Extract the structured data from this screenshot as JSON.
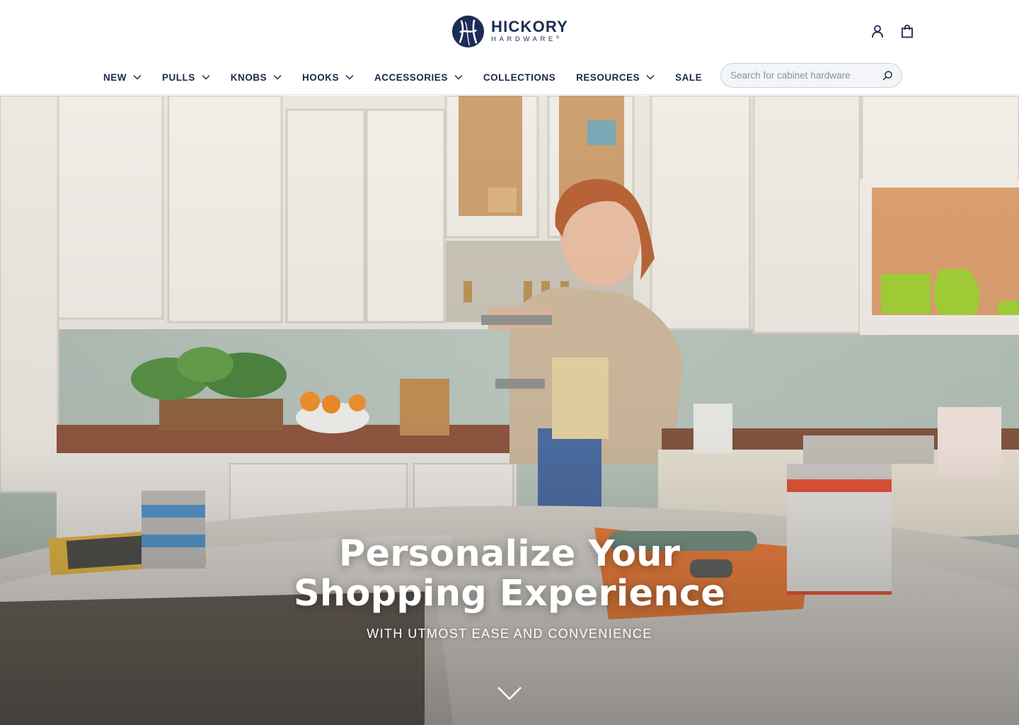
{
  "brand": {
    "name": "HICKORY",
    "tagline": "HARDWARE",
    "registered": "®",
    "navy": "#1c2d55"
  },
  "header_icons": [
    {
      "name": "account-icon"
    },
    {
      "name": "shopping-bag-icon"
    }
  ],
  "nav": {
    "items": [
      {
        "label": "NEW",
        "has_dropdown": true
      },
      {
        "label": "PULLS",
        "has_dropdown": true
      },
      {
        "label": "KNOBS",
        "has_dropdown": true
      },
      {
        "label": "HOOKS",
        "has_dropdown": true
      },
      {
        "label": "ACCESSORIES",
        "has_dropdown": true
      },
      {
        "label": "COLLECTIONS",
        "has_dropdown": false
      },
      {
        "label": "RESOURCES",
        "has_dropdown": true
      },
      {
        "label": "SALE",
        "has_dropdown": false
      }
    ]
  },
  "search": {
    "placeholder": "Search for cabinet hardware",
    "value": "",
    "icon": "search-icon"
  },
  "hero": {
    "title_line1": "Personalize Your",
    "title_line2": "Shopping Experience",
    "subtitle": "WITH UTMOST EASE AND CONVENIENCE",
    "scroll_icon": "chevron-down-icon"
  }
}
